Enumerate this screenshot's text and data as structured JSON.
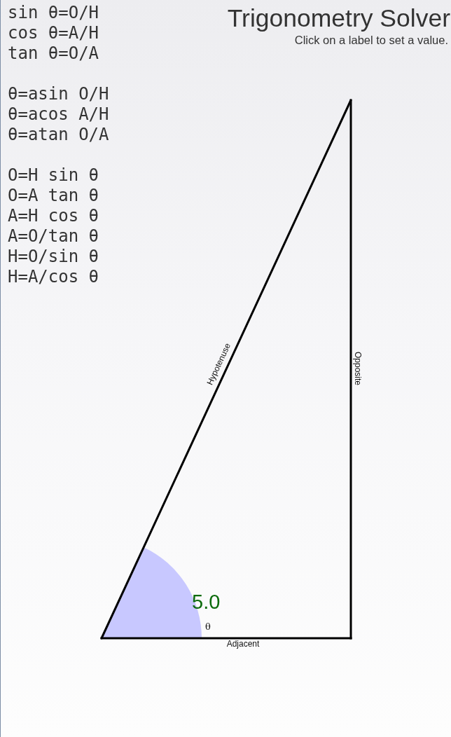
{
  "header": {
    "title": "Trigonometry Solver",
    "subtitle": "Click on a label to set a value."
  },
  "formula_groups": [
    [
      "sin θ=O/H",
      "cos θ=A/H",
      "tan θ=O/A"
    ],
    [
      "θ=asin O/H",
      "θ=acos A/H",
      "θ=atan O/A"
    ],
    [
      "O=H sin θ",
      "O=A tan θ",
      "A=H cos θ",
      "A=O/tan θ",
      "H=O/sin θ",
      "H=A/cos θ"
    ]
  ],
  "triangle": {
    "hypotenuse_label": "Hypotenuse",
    "opposite_label": "Opposite",
    "adjacent_label": "Adjacent",
    "angle_symbol": "θ",
    "angle_value": "5.0"
  }
}
